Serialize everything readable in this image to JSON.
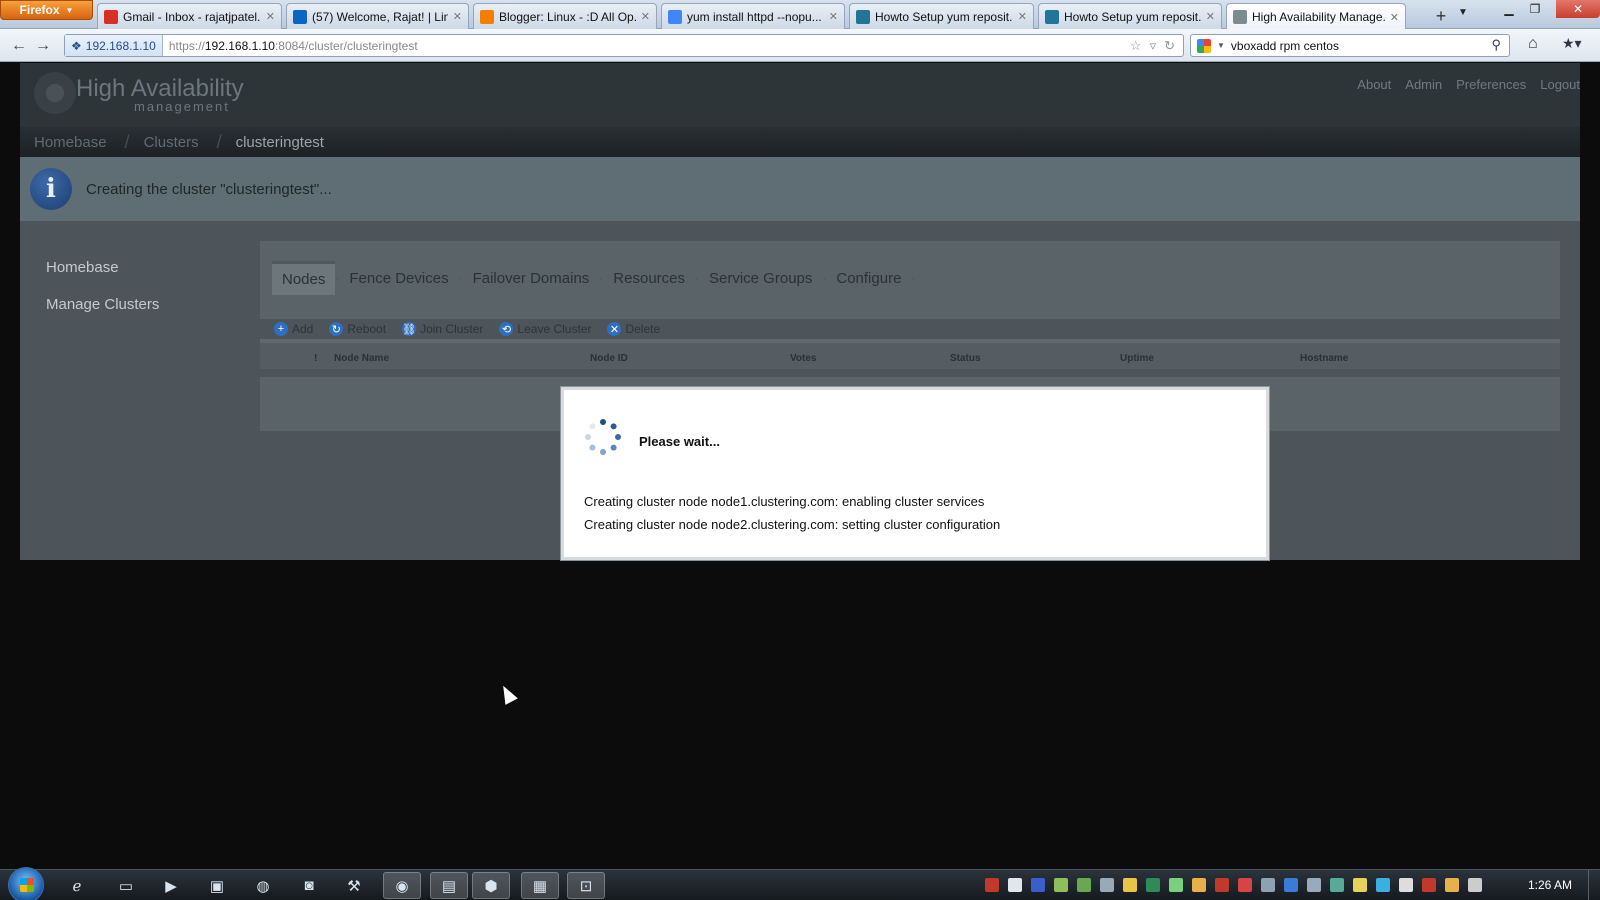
{
  "browser": {
    "menu_label": "Firefox",
    "tabs": [
      {
        "title": "Gmail - Inbox - rajatjpatel...",
        "icon": "gmail-icon",
        "color": "#d93025"
      },
      {
        "title": "(57) Welcome, Rajat! | Lin...",
        "icon": "linkedin-icon",
        "color": "#0a66c2"
      },
      {
        "title": "Blogger: Linux - :D All Op...",
        "icon": "blogger-icon",
        "color": "#f57d00"
      },
      {
        "title": "yum install httpd --nopu...",
        "icon": "google-icon",
        "color": "#4285f4"
      },
      {
        "title": "Howto Setup yum reposit...",
        "icon": "wordpress-icon",
        "color": "#21759b"
      },
      {
        "title": "Howto Setup yum reposit...",
        "icon": "wordpress-icon",
        "color": "#21759b"
      },
      {
        "title": "High Availability Manage...",
        "icon": "ha-icon",
        "color": "#7d8a92"
      }
    ],
    "url_identity": "192.168.1.10",
    "url_prefix": "https://",
    "url_host": "192.168.1.10",
    "url_rest": ":8084/cluster/clusteringtest",
    "search_value": "vboxadd rpm centos"
  },
  "app": {
    "title": "High Availability",
    "subtitle": "management",
    "top_links": [
      "About",
      "Admin",
      "Preferences",
      "Logout"
    ],
    "breadcrumb": [
      "Homebase",
      "Clusters"
    ],
    "breadcrumb_current": "clusteringtest",
    "info_message": "Creating the cluster \"clusteringtest\"...",
    "sidebar": [
      "Homebase",
      "Manage Clusters"
    ],
    "tabs": [
      "Nodes",
      "Fence Devices",
      "Failover Domains",
      "Resources",
      "Service Groups",
      "Configure"
    ],
    "toolbar": [
      {
        "label": "Add",
        "icon": "add-icon",
        "color": "#2f6fbf"
      },
      {
        "label": "Reboot",
        "icon": "reboot-icon",
        "color": "#2f6fbf"
      },
      {
        "label": "Join Cluster",
        "icon": "join-icon",
        "color": "#2f6fbf"
      },
      {
        "label": "Leave Cluster",
        "icon": "leave-icon",
        "color": "#2f6fbf"
      },
      {
        "label": "Delete",
        "icon": "delete-icon",
        "color": "#2f6fbf"
      }
    ],
    "grid_columns": [
      "!",
      "Node Name",
      "Node ID",
      "Votes",
      "Status",
      "Uptime",
      "Hostname"
    ]
  },
  "modal": {
    "title": "Please wait...",
    "lines": [
      "Creating cluster node node1.clustering.com: enabling cluster services",
      "Creating cluster node node2.clustering.com: setting cluster configuration"
    ]
  },
  "taskbar": {
    "clock": "1:26 AM"
  }
}
